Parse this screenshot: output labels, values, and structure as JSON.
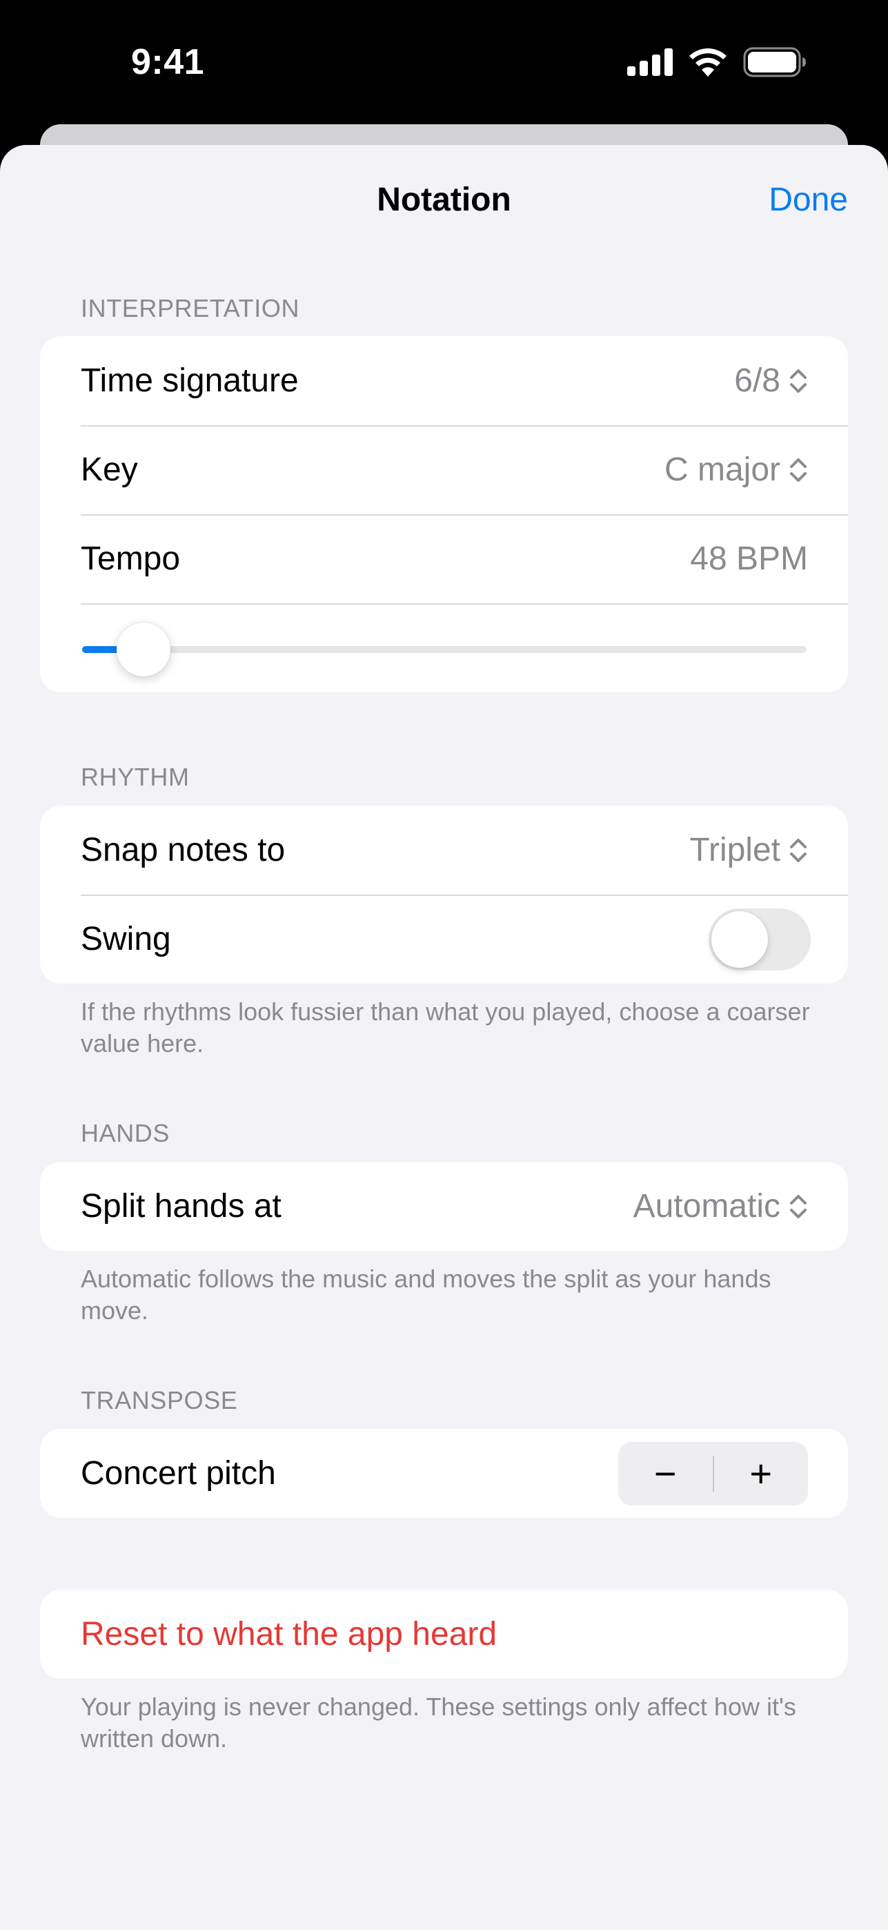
{
  "status_bar": {
    "time": "9:41"
  },
  "nav": {
    "title": "Notation",
    "done_label": "Done"
  },
  "interpretation": {
    "header": "INTERPRETATION",
    "time_signature": {
      "label": "Time signature",
      "value": "6/8"
    },
    "key": {
      "label": "Key",
      "value": "C major"
    },
    "tempo": {
      "label": "Tempo",
      "value": "48 BPM",
      "slider_fraction": 0.085
    }
  },
  "rhythm": {
    "header": "RHYTHM",
    "snap": {
      "label": "Snap notes to",
      "value": "Triplet"
    },
    "swing": {
      "label": "Swing",
      "on": false
    },
    "footer": "If the rhythms look fussier than what you played, choose a coarser value here."
  },
  "hands": {
    "header": "HANDS",
    "split": {
      "label": "Split hands at",
      "value": "Automatic"
    },
    "footer": "Automatic follows the music and moves the split as your hands move."
  },
  "transpose": {
    "header": "TRANSPOSE",
    "concert_pitch": {
      "label": "Concert pitch",
      "minus": "−",
      "plus": "+"
    }
  },
  "reset": {
    "label": "Reset to what the app heard",
    "footer": "Your playing is never changed. These settings only affect how it's written down."
  },
  "colors": {
    "accent": "#0a7cf0",
    "destructive": "#e53935",
    "secondary_text": "#8a8a8e"
  }
}
